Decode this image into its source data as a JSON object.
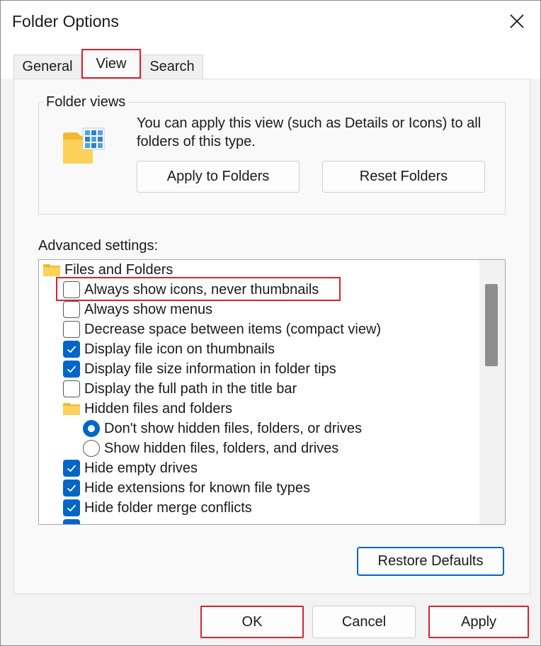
{
  "window": {
    "title": "Folder Options",
    "close_icon": "close-icon"
  },
  "tabs": [
    {
      "label": "General"
    },
    {
      "label": "View"
    },
    {
      "label": "Search"
    }
  ],
  "folder_views": {
    "label": "Folder views",
    "description": "You can apply this view (such as Details or Icons) to all folders of this type.",
    "apply_button": "Apply to Folders",
    "reset_button": "Reset Folders"
  },
  "advanced": {
    "label": "Advanced settings:",
    "items": [
      {
        "kind": "folder",
        "label": "Files and Folders"
      },
      {
        "kind": "checkbox",
        "checked": false,
        "label": "Always show icons, never thumbnails"
      },
      {
        "kind": "checkbox",
        "checked": false,
        "label": "Always show menus"
      },
      {
        "kind": "checkbox",
        "checked": false,
        "label": "Decrease space between items (compact view)"
      },
      {
        "kind": "checkbox",
        "checked": true,
        "label": "Display file icon on thumbnails"
      },
      {
        "kind": "checkbox",
        "checked": true,
        "label": "Display file size information in folder tips"
      },
      {
        "kind": "checkbox",
        "checked": false,
        "label": "Display the full path in the title bar"
      },
      {
        "kind": "folder",
        "label": "Hidden files and folders"
      },
      {
        "kind": "radio",
        "checked": true,
        "label": "Don't show hidden files, folders, or drives"
      },
      {
        "kind": "radio",
        "checked": false,
        "label": "Show hidden files, folders, and drives"
      },
      {
        "kind": "checkbox",
        "checked": true,
        "label": "Hide empty drives"
      },
      {
        "kind": "checkbox",
        "checked": true,
        "label": "Hide extensions for known file types"
      },
      {
        "kind": "checkbox",
        "checked": true,
        "label": "Hide folder merge conflicts"
      }
    ],
    "restore_button": "Restore Defaults"
  },
  "footer": {
    "ok": "OK",
    "cancel": "Cancel",
    "apply": "Apply"
  },
  "colors": {
    "accent": "#0066c8",
    "highlight": "#d9232e"
  }
}
